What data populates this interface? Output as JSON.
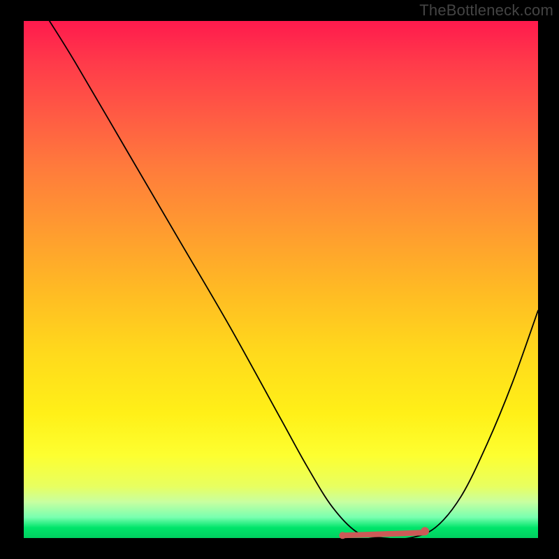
{
  "attribution": "TheBottleneck.com",
  "chart_data": {
    "type": "line",
    "title": "",
    "xlabel": "",
    "ylabel": "",
    "xlim": [
      0,
      100
    ],
    "ylim": [
      0,
      100
    ],
    "grid": false,
    "series": [
      {
        "name": "bottleneck-curve",
        "x": [
          5,
          10,
          20,
          30,
          40,
          50,
          55,
          60,
          65,
          70,
          75,
          80,
          85,
          90,
          95,
          100
        ],
        "values": [
          100,
          92,
          75,
          58,
          41,
          23,
          14,
          6,
          1,
          0,
          0,
          2,
          8,
          18,
          30,
          44
        ]
      }
    ],
    "optimal_range": {
      "start_x": 62,
      "end_x": 78,
      "y": 0.5
    },
    "annotations": []
  },
  "colors": {
    "curve": "#000000",
    "marker": "#cc5a57",
    "frame_bg": "#000000"
  }
}
